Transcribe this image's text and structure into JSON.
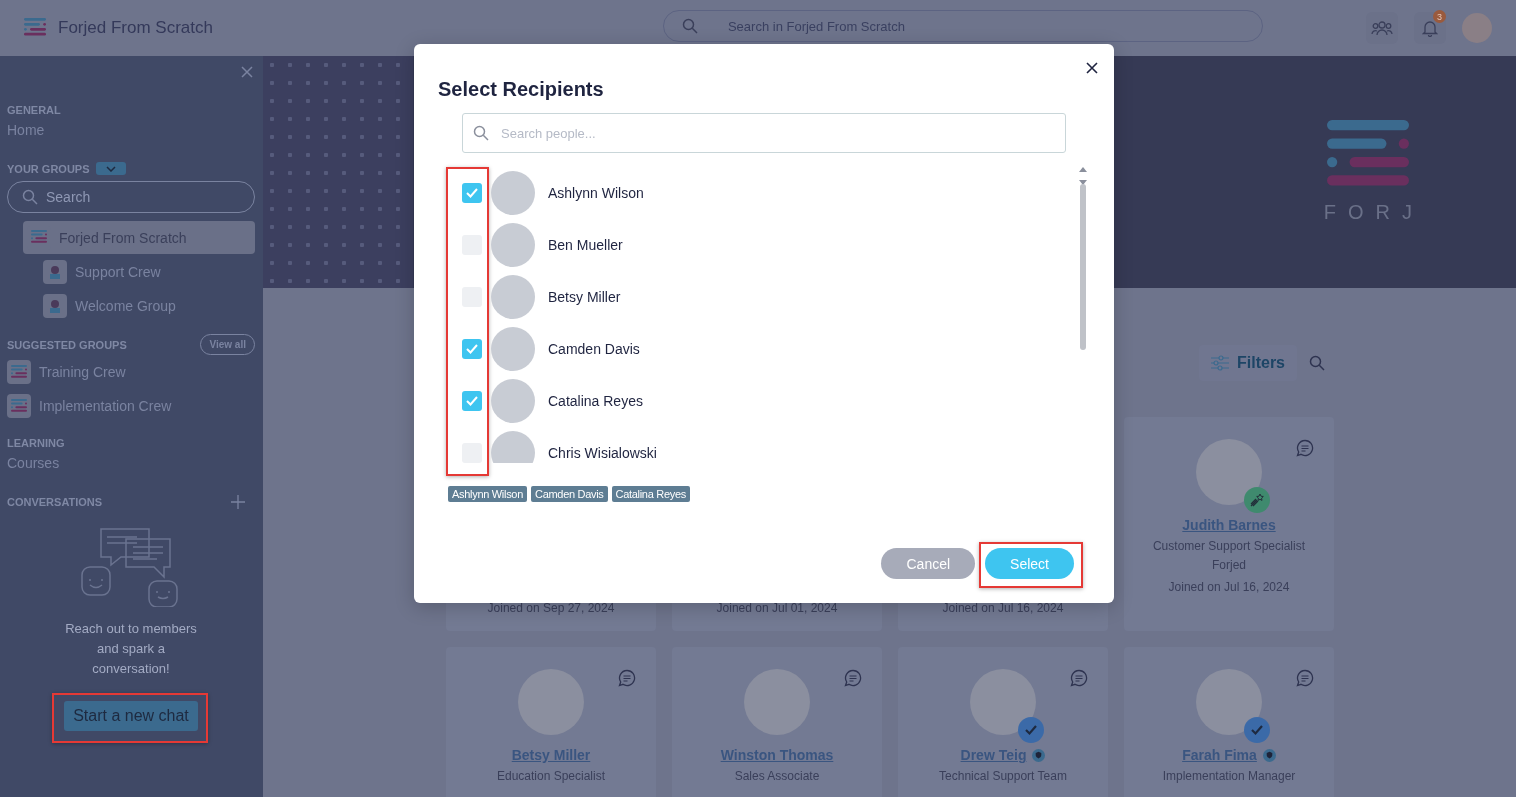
{
  "header": {
    "title": "Forjed From Scratch",
    "search_placeholder": "Search in Forjed From Scratch",
    "notification_count": "3"
  },
  "sidebar": {
    "general_label": "GENERAL",
    "home": "Home",
    "groups_label": "YOUR GROUPS",
    "search_placeholder": "Search",
    "groups": [
      {
        "name": "Forjed From Scratch",
        "selected": true
      },
      {
        "name": "Support Crew",
        "selected": false
      },
      {
        "name": "Welcome Group",
        "selected": false
      }
    ],
    "suggested_label": "SUGGESTED GROUPS",
    "view_all": "View all",
    "suggested": [
      "Training Crew",
      "Implementation Crew"
    ],
    "learning_label": "LEARNING",
    "courses": "Courses",
    "conversations_label": "CONVERSATIONS",
    "empty_text": "Reach out to members and spark a conversation!",
    "start_chat": "Start a new chat"
  },
  "banner": {
    "logo_text": "FORJ"
  },
  "toolbar": {
    "filters": "Filters"
  },
  "members": [
    {
      "kind": "covered",
      "joined": "Joined on Sep 27, 2024"
    },
    {
      "kind": "covered",
      "joined": "Joined on Jul 01, 2024"
    },
    {
      "kind": "covered",
      "joined": "Joined on Jul 16, 2024"
    },
    {
      "kind": "full",
      "name": "Judith Barnes",
      "title": "Customer Support Specialist",
      "company": "Forjed",
      "joined": "Joined on Jul 16, 2024",
      "star_badge": true,
      "verified": false,
      "shield": false
    },
    {
      "kind": "full",
      "name": "Betsy Miller",
      "title": "Education Specialist",
      "star_badge": false,
      "verified": false,
      "shield": false
    },
    {
      "kind": "full",
      "name": "Winston Thomas",
      "title": "Sales Associate",
      "star_badge": false,
      "verified": false,
      "shield": false
    },
    {
      "kind": "full",
      "name": "Drew Teig",
      "title": "Technical Support Team",
      "star_badge": false,
      "verified": true,
      "shield": true
    },
    {
      "kind": "full",
      "name": "Farah Fima",
      "title": "Implementation Manager",
      "star_badge": false,
      "verified": true,
      "shield": true
    }
  ],
  "modal": {
    "title": "Select Recipients",
    "search_placeholder": "Search people...",
    "people": [
      {
        "name": "Ashlynn Wilson",
        "checked": true
      },
      {
        "name": "Ben Mueller",
        "checked": false
      },
      {
        "name": "Betsy Miller",
        "checked": false
      },
      {
        "name": "Camden Davis",
        "checked": true
      },
      {
        "name": "Catalina Reyes",
        "checked": true
      },
      {
        "name": "Chris Wisialowski",
        "checked": false
      }
    ],
    "chips": [
      "Ashlynn Wilson",
      "Camden Davis",
      "Catalina Reyes"
    ],
    "cancel": "Cancel",
    "select": "Select"
  }
}
